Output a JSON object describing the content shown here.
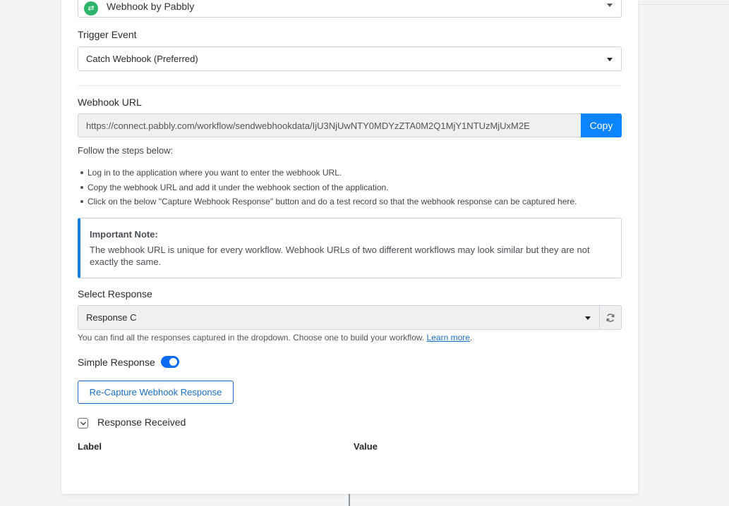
{
  "app_select": {
    "logo_glyph": "⇄",
    "app_name": "Webhook by Pabbly"
  },
  "trigger": {
    "label": "Trigger Event",
    "value": "Catch Webhook (Preferred)"
  },
  "webhook": {
    "label": "Webhook URL",
    "url": "https://connect.pabbly.com/workflow/sendwebhookdata/IjU3NjUwNTY0MDYzZTA0M2Q1MjY1NTUzMjUxM2E",
    "copy_label": "Copy"
  },
  "steps": {
    "intro": "Follow the steps below:",
    "items": [
      "Log in to the application where you want to enter the webhook URL.",
      "Copy the webhook URL and add it under the webhook section of the application.",
      "Click on the below \"Capture Webhook Response\" button and do a test record so that the webhook response can be captured here."
    ]
  },
  "note": {
    "title": "Important Note:",
    "body": "The webhook URL is unique for every workflow. Webhook URLs of two different workflows may look similar but they are not exactly the same."
  },
  "response": {
    "label": "Select Response",
    "value": "Response C",
    "help_text": "You can find all the responses captured in the dropdown. Choose one to build your workflow.",
    "learn_more": "Learn more",
    "help_suffix": "."
  },
  "simple_response": {
    "label": "Simple Response",
    "enabled": true
  },
  "recapture_label": "Re-Capture Webhook Response",
  "response_received": {
    "label": "Response Received",
    "checked": true
  },
  "table": {
    "col_label": "Label",
    "col_value": "Value"
  },
  "colors": {
    "accent": "#0a84ff",
    "toggle_on": "#0a6cf5",
    "note_border": "#1a7fd4",
    "link": "#1a6fc9"
  }
}
